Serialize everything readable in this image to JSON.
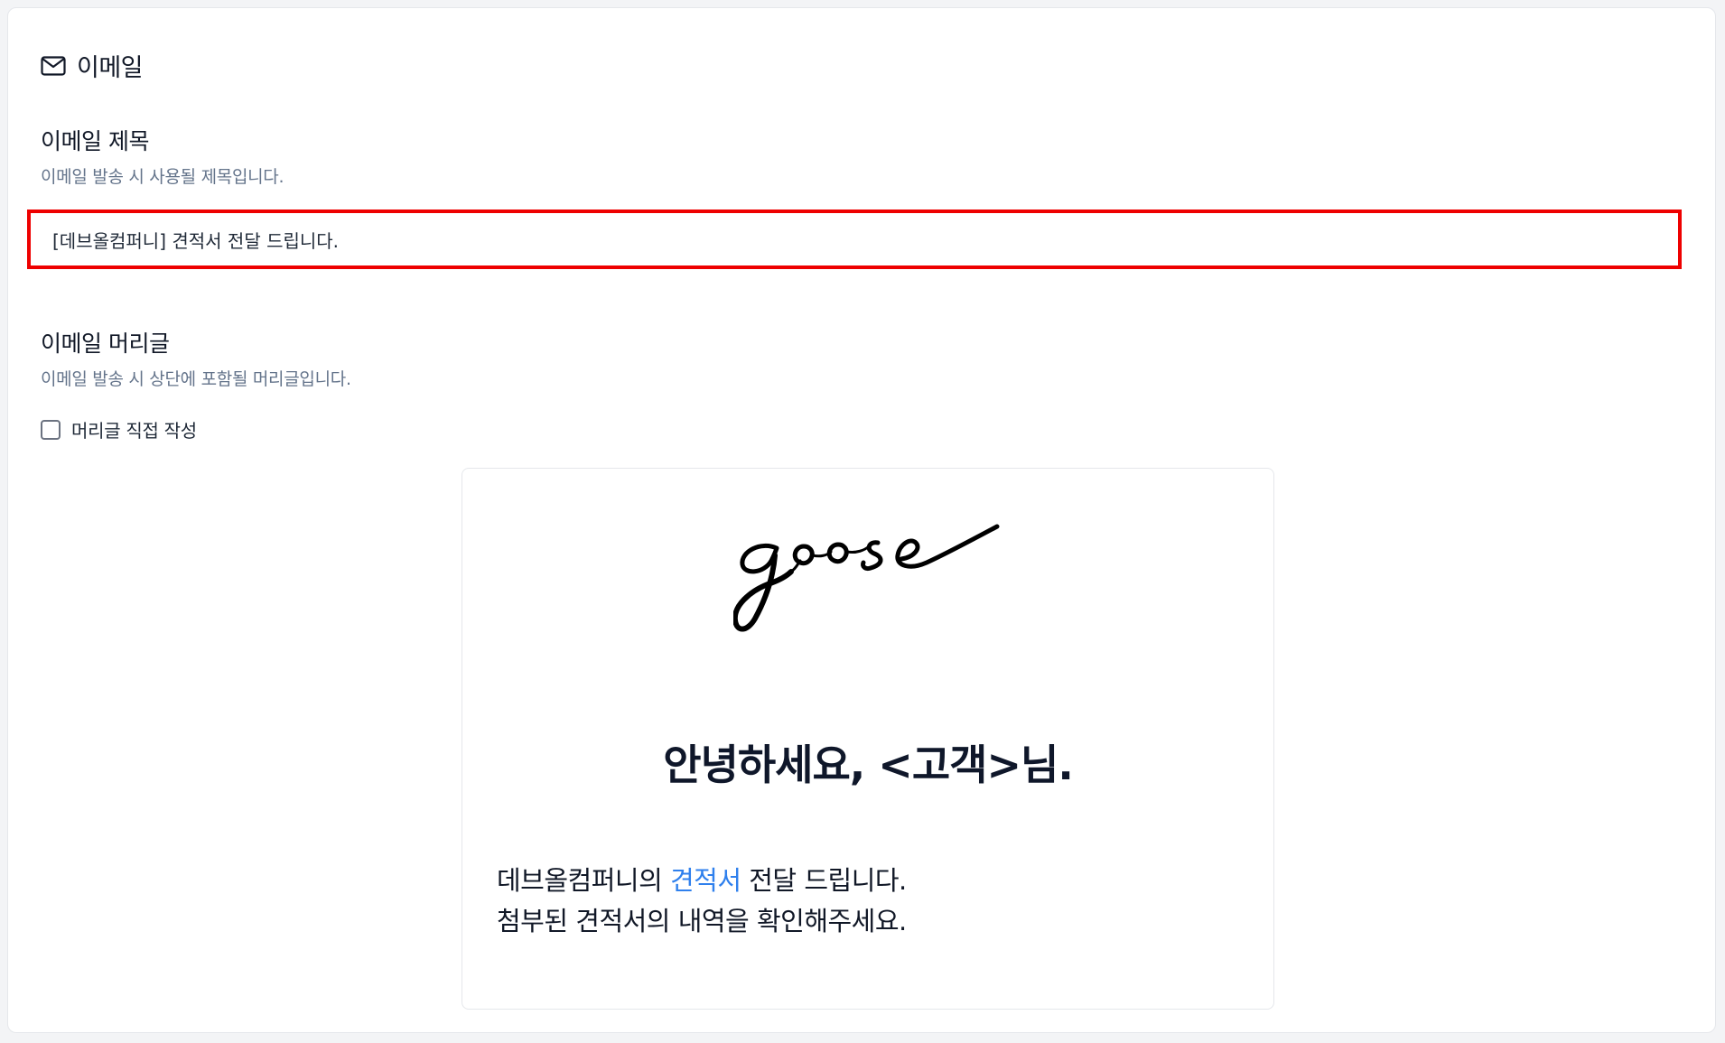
{
  "section": {
    "title": "이메일",
    "icon": "mail-icon"
  },
  "subject": {
    "label": "이메일 제목",
    "help": "이메일 발송 시 사용될 제목입니다.",
    "value": "[데브올컴퍼니] 견적서 전달 드립니다."
  },
  "header": {
    "label": "이메일 머리글",
    "help": "이메일 발송 시 상단에 포함될 머리글입니다.",
    "checkbox_label": "머리글 직접 작성",
    "checkbox_checked": false
  },
  "preview": {
    "logo_text": "goose",
    "greeting": "안녕하세요, <고객>님.",
    "line1_before": "데브올컴퍼니의 ",
    "line1_highlight": "견적서",
    "line1_after": " 전달 드립니다.",
    "line2": "첨부된 견적서의 내역을 확인해주세요."
  },
  "colors": {
    "highlight": "#2f80ed",
    "focus_border": "#ee0000",
    "help_text": "#64748b"
  }
}
